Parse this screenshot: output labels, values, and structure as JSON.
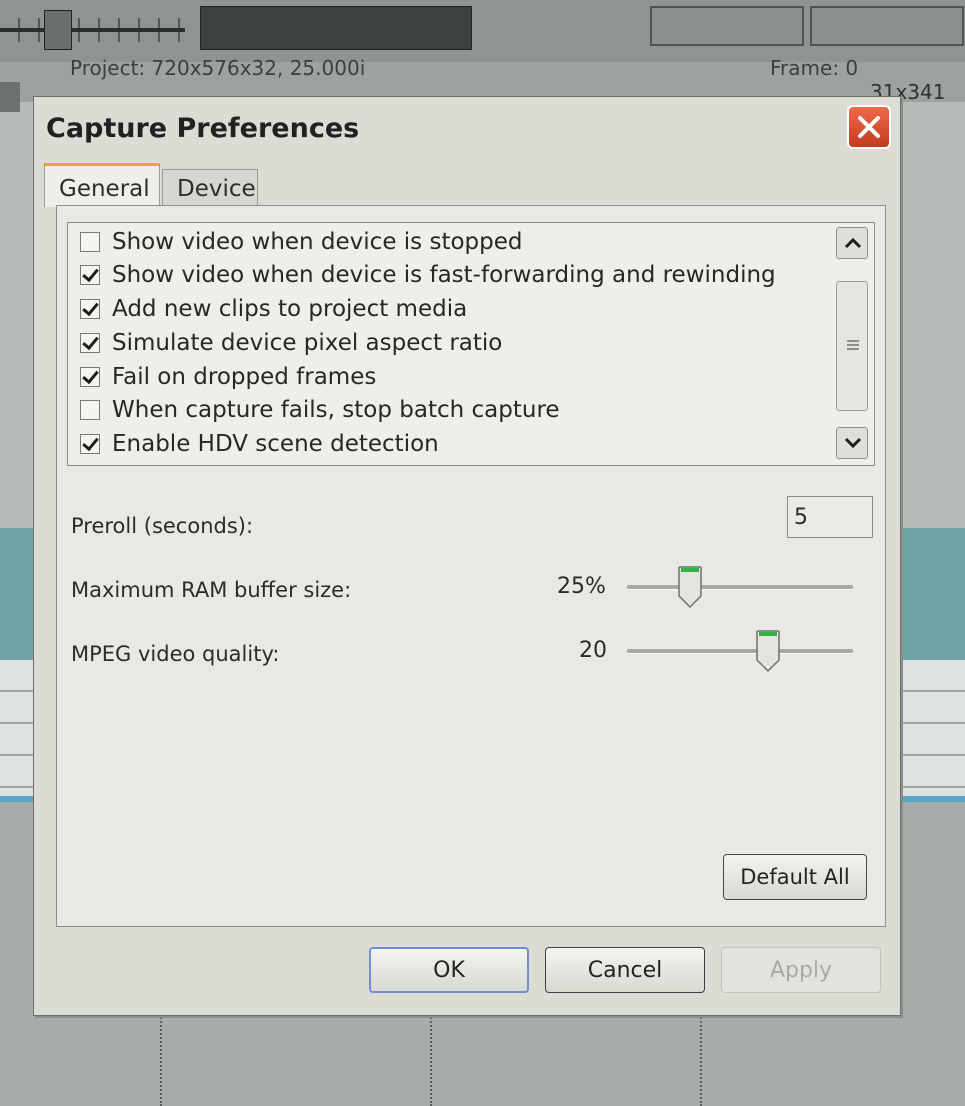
{
  "background": {
    "info_text": "Project:   720x576x32, 25.000i",
    "info_right": "Frame:   0",
    "resolution": "31x341"
  },
  "dialog": {
    "title": "Capture Preferences",
    "tabs": [
      {
        "label": "General",
        "selected": true
      },
      {
        "label": "Device",
        "selected": false
      }
    ],
    "options": [
      {
        "label": "Show video when device is stopped",
        "checked": false
      },
      {
        "label": "Show video when device is fast-forwarding and rewinding",
        "checked": true
      },
      {
        "label": "Add new clips to project media",
        "checked": true
      },
      {
        "label": "Simulate device pixel aspect ratio",
        "checked": true
      },
      {
        "label": "Fail on dropped frames",
        "checked": true
      },
      {
        "label": "When capture fails, stop batch capture",
        "checked": false
      },
      {
        "label": "Enable HDV scene detection",
        "checked": true
      }
    ],
    "preroll": {
      "label": "Preroll (seconds):",
      "value": "5"
    },
    "ram_buffer": {
      "label": "Maximum RAM buffer size:",
      "value": "25%",
      "level": 0.25
    },
    "mpeg_quality": {
      "label": "MPEG video quality:",
      "value": "20",
      "level": 0.64
    },
    "default_all": "Default All",
    "buttons": {
      "ok": "OK",
      "cancel": "Cancel",
      "apply": "Apply"
    },
    "colors": {
      "close": "#d84b2c",
      "tab_accent": "#e7a533",
      "slider_thumb": "#2fb34a"
    }
  }
}
